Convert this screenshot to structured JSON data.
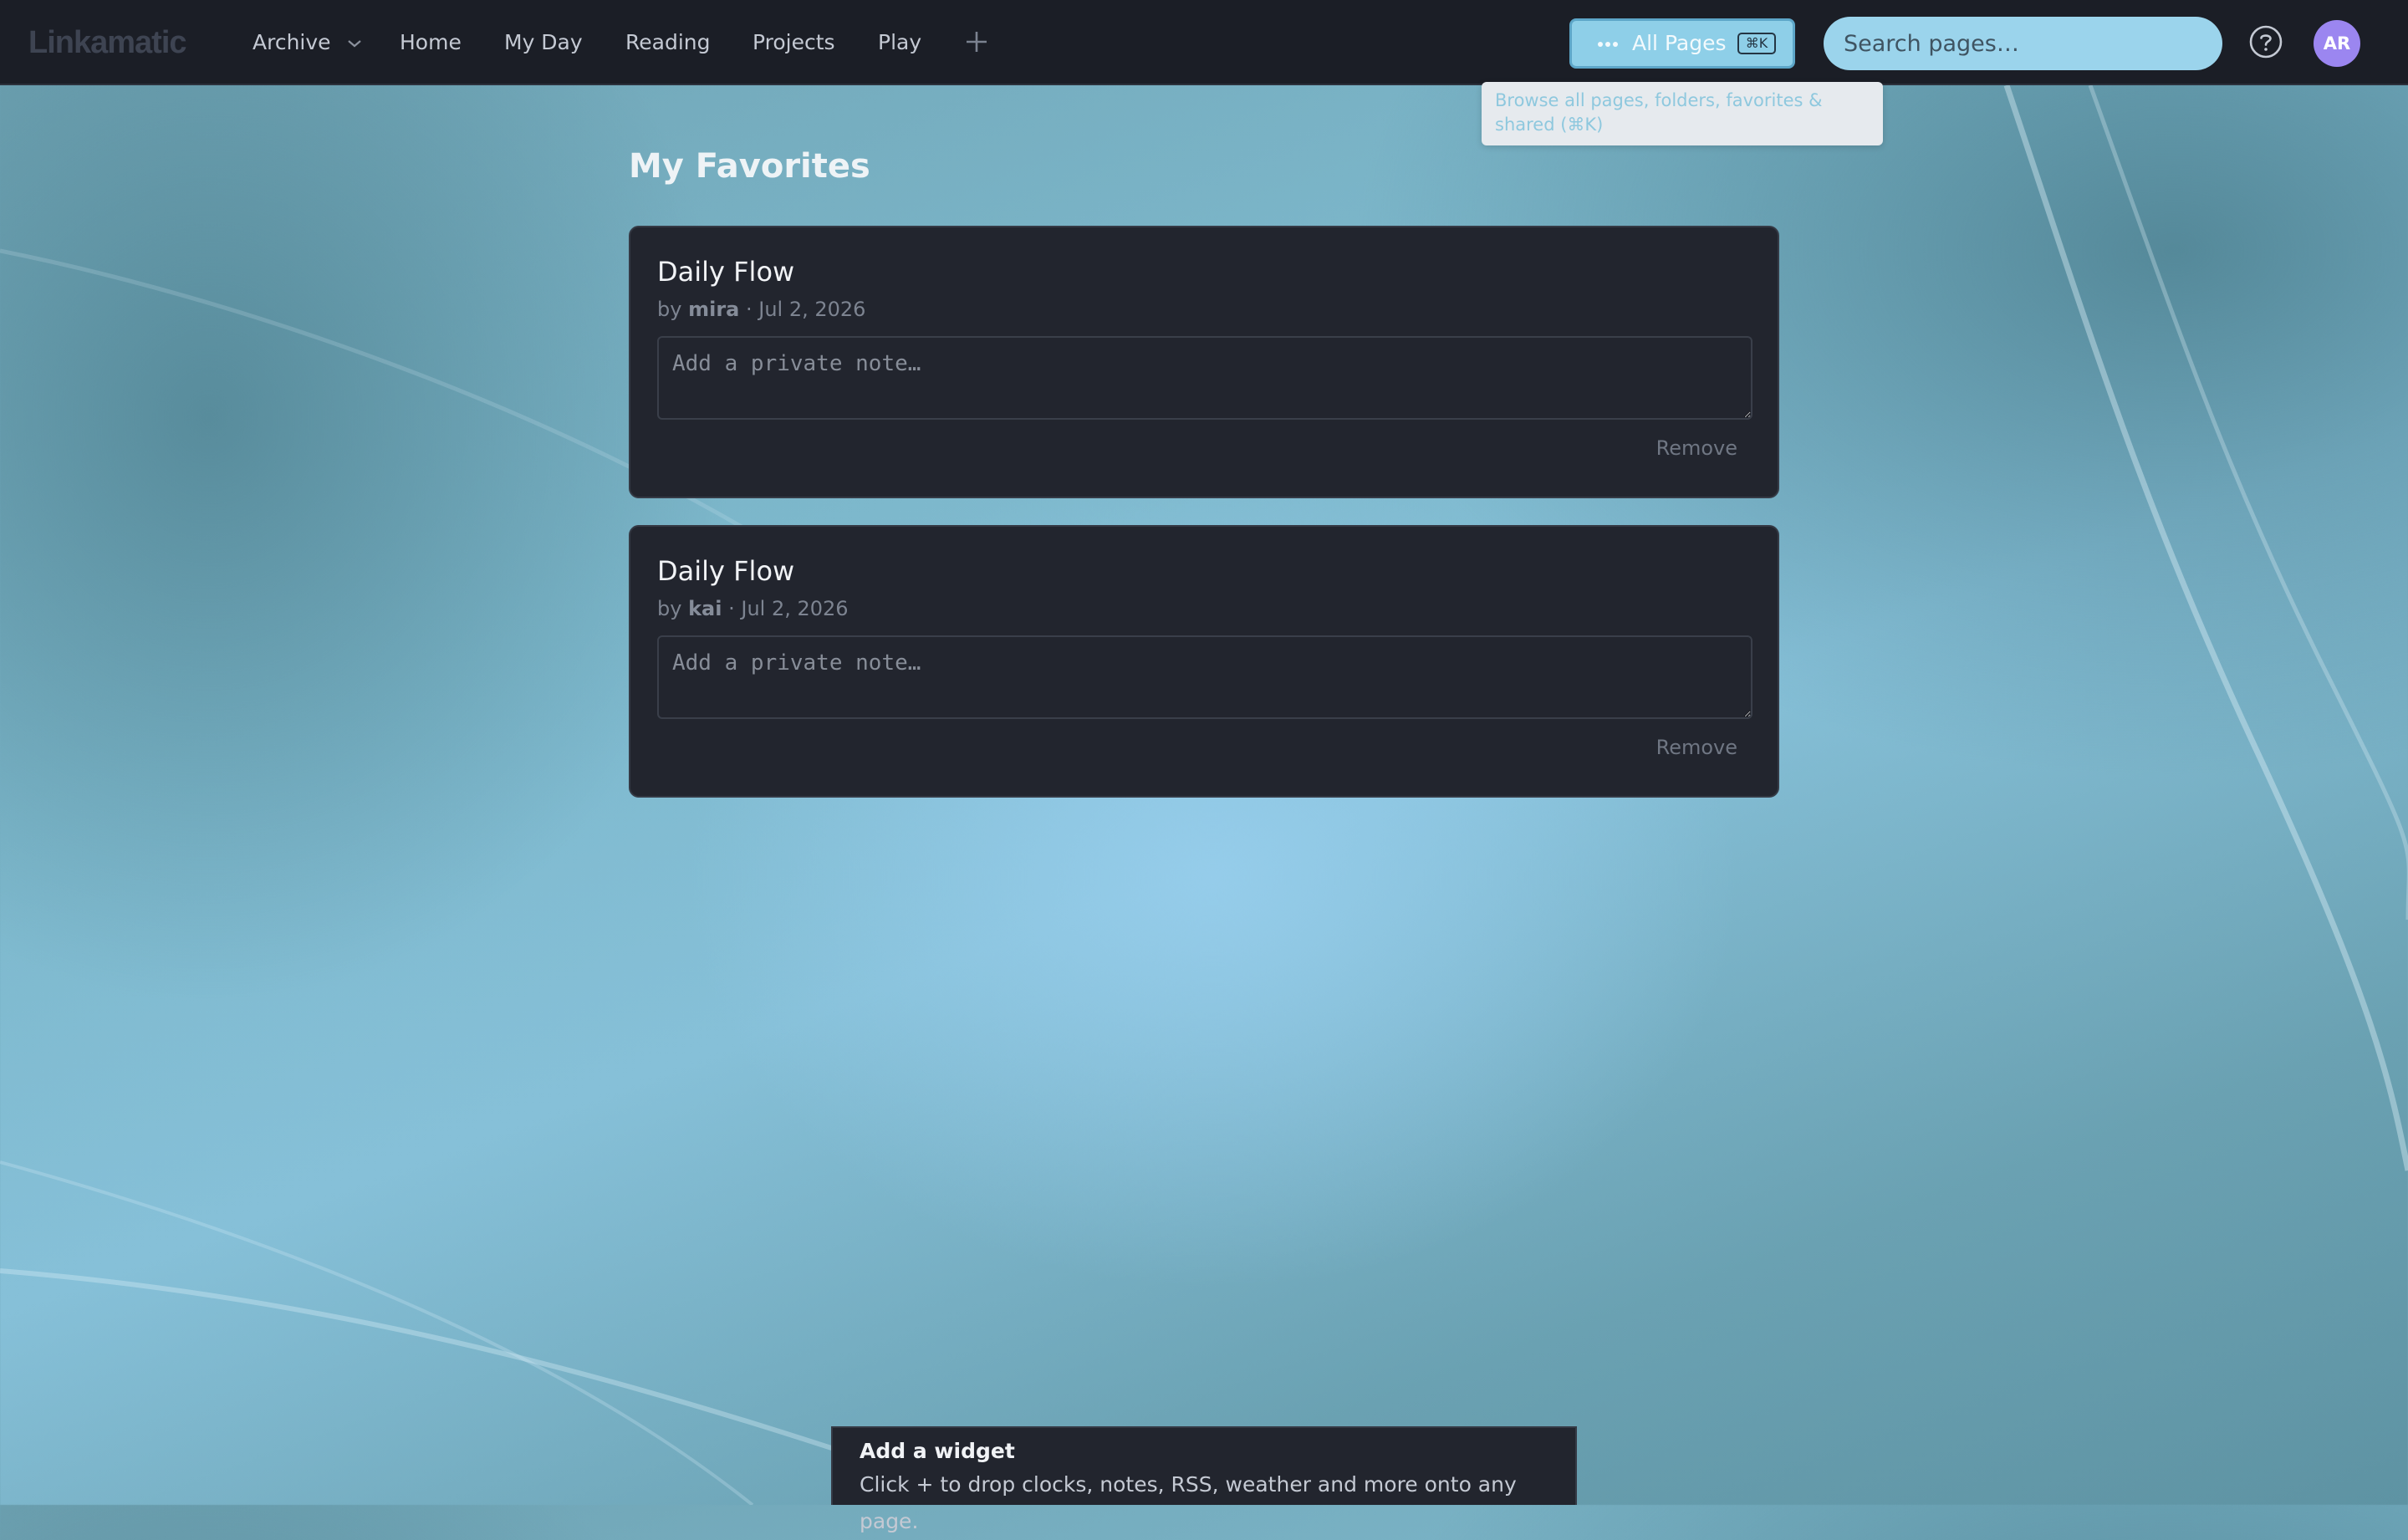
{
  "app": {
    "logo": "Linkamatic"
  },
  "nav": {
    "archive": "Archive",
    "items": [
      "Home",
      "My Day",
      "Reading",
      "Projects",
      "Play"
    ],
    "add_icon": "plus-icon"
  },
  "header": {
    "all_pages_label": "All Pages",
    "all_pages_shortcut": "⌘K",
    "search_placeholder": "Search pages…",
    "help_icon": "help-circle-icon",
    "avatar_initials": "AR"
  },
  "tooltip": {
    "text": "Browse all pages, folders, favorites & shared (⌘K)"
  },
  "main": {
    "title": "My Favorites",
    "favorites": [
      {
        "title": "Daily Flow",
        "by": "by",
        "author": "mira",
        "date": "· Jul 2, 2026",
        "note_placeholder": "Add a private note…",
        "remove_label": "Remove"
      },
      {
        "title": "Daily Flow",
        "by": "by",
        "author": "kai",
        "date": "· Jul 2, 2026",
        "note_placeholder": "Add a private note…",
        "remove_label": "Remove"
      }
    ]
  },
  "widget_hint": {
    "title": "Add a widget",
    "body": "Click + to drop clocks, notes, RSS, weather and more onto any page."
  },
  "colors": {
    "topbar": "#1b1e26",
    "accent": "#8ecfe8",
    "card": "#22252e",
    "avatar": "#9b86f0"
  }
}
